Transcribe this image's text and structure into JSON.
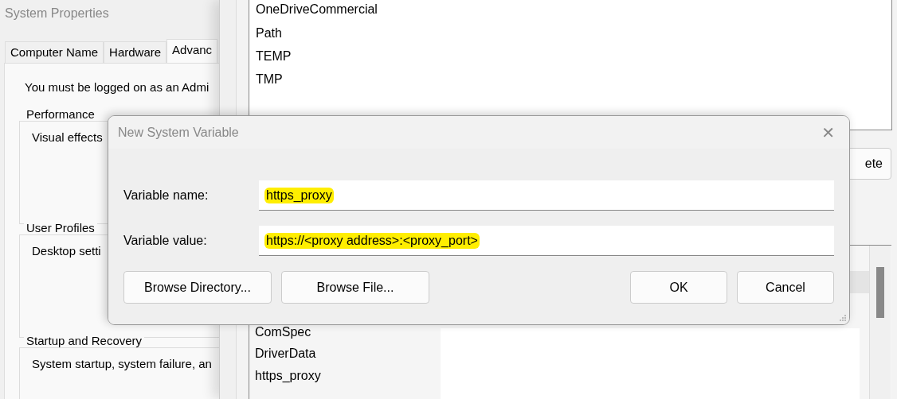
{
  "system_properties": {
    "title": "System Properties",
    "tabs": [
      {
        "label": "Computer Name",
        "selected": false
      },
      {
        "label": "Hardware",
        "selected": false
      },
      {
        "label": "Advanc",
        "selected": true
      }
    ],
    "notice": "You must be logged on as an Admi",
    "groups": [
      {
        "legend": "Performance",
        "text": "Visual effects"
      },
      {
        "legend": "User Profiles",
        "text": "Desktop setti"
      },
      {
        "legend": "Startup and Recovery",
        "text": "System startup, system failure, an"
      }
    ]
  },
  "environment_variables": {
    "user_variables": [
      "OneDriveCommercial",
      "Path",
      "TEMP",
      "TMP"
    ],
    "user_button": "ete",
    "system_variables": [
      {
        "name": "ComSpec"
      },
      {
        "name": "DriverData"
      },
      {
        "name": "https_proxy"
      }
    ]
  },
  "dialog": {
    "title": "New System Variable",
    "close": "✕",
    "fields": [
      {
        "label": "Variable name:",
        "value": "https_proxy",
        "highlighted": true
      },
      {
        "label": "Variable value:",
        "value": "https://<proxy address>:<proxy_port>",
        "highlighted": true
      }
    ],
    "browse_buttons": [
      "Browse Directory...",
      "Browse File..."
    ],
    "buttons": [
      "OK",
      "Cancel"
    ]
  }
}
